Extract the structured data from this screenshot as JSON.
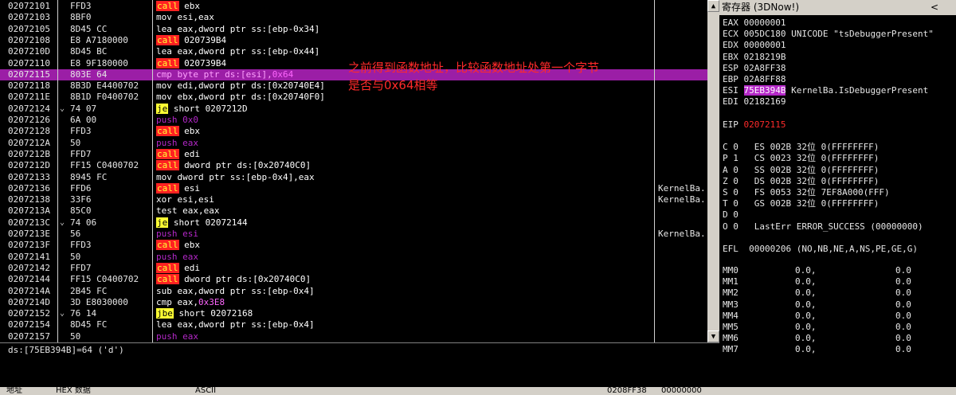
{
  "disasm": {
    "rows": [
      {
        "addr": "02072101",
        "jmp": "",
        "hex": "FFD3",
        "asm": [
          [
            "call",
            "call"
          ],
          [
            "ebx",
            "norm"
          ]
        ],
        "cmt": ""
      },
      {
        "addr": "02072103",
        "jmp": "",
        "hex": "8BF0",
        "asm": [
          [
            "mov esi,eax",
            "norm"
          ]
        ],
        "cmt": ""
      },
      {
        "addr": "02072105",
        "jmp": "",
        "hex": "8D45 CC",
        "asm": [
          [
            "lea eax,dword ptr ss:[ebp-0x34]",
            "norm"
          ]
        ],
        "cmt": ""
      },
      {
        "addr": "02072108",
        "jmp": "",
        "hex": "E8 A7180000",
        "asm": [
          [
            "call",
            "call"
          ],
          [
            "020739B4",
            "norm"
          ]
        ],
        "cmt": ""
      },
      {
        "addr": "0207210D",
        "jmp": "",
        "hex": "8D45 BC",
        "asm": [
          [
            "lea eax,dword ptr ss:[ebp-0x44]",
            "norm"
          ]
        ],
        "cmt": ""
      },
      {
        "addr": "02072110",
        "jmp": "",
        "hex": "E8 9F180000",
        "asm": [
          [
            "call",
            "call"
          ],
          [
            "020739B4",
            "norm"
          ]
        ],
        "cmt": ""
      },
      {
        "addr": "02072115",
        "jmp": "",
        "hex": "803E 64",
        "asm": [
          [
            "cmp byte ptr ds:[esi],",
            "cmp"
          ],
          [
            "0x64",
            "imm"
          ]
        ],
        "cmt": "",
        "sel": true
      },
      {
        "addr": "02072118",
        "jmp": "",
        "hex": "8B3D E4400702",
        "asm": [
          [
            "mov edi,dword ptr ds:[0x20740E4]",
            "norm"
          ]
        ],
        "cmt": ""
      },
      {
        "addr": "0207211E",
        "jmp": "",
        "hex": "8B1D F0400702",
        "asm": [
          [
            "mov ebx,dword ptr ds:[0x20740F0]",
            "norm"
          ]
        ],
        "cmt": ""
      },
      {
        "addr": "02072124",
        "jmp": "⌄",
        "hex": "74 07",
        "asm": [
          [
            "je",
            "jcc"
          ],
          [
            "short 0207212D",
            "norm"
          ]
        ],
        "cmt": ""
      },
      {
        "addr": "02072126",
        "jmp": "",
        "hex": "6A 00",
        "asm": [
          [
            "push 0x0",
            "push"
          ]
        ],
        "cmt": ""
      },
      {
        "addr": "02072128",
        "jmp": "",
        "hex": "FFD3",
        "asm": [
          [
            "call",
            "call"
          ],
          [
            "ebx",
            "norm"
          ]
        ],
        "cmt": ""
      },
      {
        "addr": "0207212A",
        "jmp": "",
        "hex": "50",
        "asm": [
          [
            "push eax",
            "push"
          ]
        ],
        "cmt": ""
      },
      {
        "addr": "0207212B",
        "jmp": "",
        "hex": "FFD7",
        "asm": [
          [
            "call",
            "call"
          ],
          [
            "edi",
            "norm"
          ]
        ],
        "cmt": ""
      },
      {
        "addr": "0207212D",
        "jmp": "",
        "hex": "FF15 C0400702",
        "asm": [
          [
            "call",
            "call"
          ],
          [
            "dword ptr ds:[0x20740C0]",
            "norm"
          ]
        ],
        "cmt": ""
      },
      {
        "addr": "02072133",
        "jmp": "",
        "hex": "8945 FC",
        "asm": [
          [
            "mov dword ptr ss:[ebp-0x4],eax",
            "norm"
          ]
        ],
        "cmt": ""
      },
      {
        "addr": "02072136",
        "jmp": "",
        "hex": "FFD6",
        "asm": [
          [
            "call",
            "call"
          ],
          [
            "esi",
            "norm"
          ]
        ],
        "cmt": "KernelBa."
      },
      {
        "addr": "02072138",
        "jmp": "",
        "hex": "33F6",
        "asm": [
          [
            "xor esi,esi",
            "norm"
          ]
        ],
        "cmt": "KernelBa."
      },
      {
        "addr": "0207213A",
        "jmp": "",
        "hex": "85C0",
        "asm": [
          [
            "test eax,eax",
            "norm"
          ]
        ],
        "cmt": ""
      },
      {
        "addr": "0207213C",
        "jmp": "⌄",
        "hex": "74 06",
        "asm": [
          [
            "je",
            "jcc"
          ],
          [
            "short 02072144",
            "norm"
          ]
        ],
        "cmt": ""
      },
      {
        "addr": "0207213E",
        "jmp": "",
        "hex": "56",
        "asm": [
          [
            "push esi",
            "push"
          ]
        ],
        "cmt": "KernelBa."
      },
      {
        "addr": "0207213F",
        "jmp": "",
        "hex": "FFD3",
        "asm": [
          [
            "call",
            "call"
          ],
          [
            "ebx",
            "norm"
          ]
        ],
        "cmt": ""
      },
      {
        "addr": "02072141",
        "jmp": "",
        "hex": "50",
        "asm": [
          [
            "push eax",
            "push"
          ]
        ],
        "cmt": ""
      },
      {
        "addr": "02072142",
        "jmp": "",
        "hex": "FFD7",
        "asm": [
          [
            "call",
            "call"
          ],
          [
            "edi",
            "norm"
          ]
        ],
        "cmt": ""
      },
      {
        "addr": "02072144",
        "jmp": "",
        "hex": "FF15 C0400702",
        "asm": [
          [
            "call",
            "call"
          ],
          [
            "dword ptr ds:[0x20740C0]",
            "norm"
          ]
        ],
        "cmt": ""
      },
      {
        "addr": "0207214A",
        "jmp": "",
        "hex": "2B45 FC",
        "asm": [
          [
            "sub eax,dword ptr ss:[ebp-0x4]",
            "norm"
          ]
        ],
        "cmt": ""
      },
      {
        "addr": "0207214D",
        "jmp": "",
        "hex": "3D E8030000",
        "asm": [
          [
            "cmp eax,",
            "norm"
          ],
          [
            "0x3E8",
            "imm"
          ]
        ],
        "cmt": ""
      },
      {
        "addr": "02072152",
        "jmp": "⌄",
        "hex": "76 14",
        "asm": [
          [
            "jbe",
            "jcc"
          ],
          [
            "short 02072168",
            "norm"
          ]
        ],
        "cmt": ""
      },
      {
        "addr": "02072154",
        "jmp": "",
        "hex": "8D45 FC",
        "asm": [
          [
            "lea eax,dword ptr ss:[ebp-0x4]",
            "norm"
          ]
        ],
        "cmt": ""
      },
      {
        "addr": "02072157",
        "jmp": "",
        "hex": "50",
        "asm": [
          [
            "push eax",
            "push"
          ]
        ],
        "cmt": ""
      }
    ],
    "annotation_line1": "之前得到函数地址，比较函数地址处第一个字节",
    "annotation_line2": "是否与0x64相等"
  },
  "info": {
    "text": "ds:[75EB394B]=64 ('d')"
  },
  "registers": {
    "title": "寄存器 (3DNow!)",
    "chevron": "<",
    "gpr": [
      {
        "name": "EAX",
        "value": "00000001",
        "note": ""
      },
      {
        "name": "ECX",
        "value": "005DC180",
        "note": "UNICODE \"tsDebuggerPresent\""
      },
      {
        "name": "EDX",
        "value": "00000001",
        "note": ""
      },
      {
        "name": "EBX",
        "value": "0218219B",
        "note": ""
      },
      {
        "name": "ESP",
        "value": "02A8FF38",
        "note": ""
      },
      {
        "name": "EBP",
        "value": "02A8FF88",
        "note": ""
      },
      {
        "name": "ESI",
        "value": "75EB394B",
        "note": "KernelBa.IsDebuggerPresent",
        "highlight": true
      },
      {
        "name": "EDI",
        "value": "02182169",
        "note": ""
      }
    ],
    "eip": {
      "name": "EIP",
      "value": "02072115"
    },
    "flags": [
      "C 0   ES 002B 32位 0(FFFFFFFF)",
      "P 1   CS 0023 32位 0(FFFFFFFF)",
      "A 0   SS 002B 32位 0(FFFFFFFF)",
      "Z 0   DS 002B 32位 0(FFFFFFFF)",
      "S 0   FS 0053 32位 7EF8A000(FFF)",
      "T 0   GS 002B 32位 0(FFFFFFFF)",
      "D 0",
      "O 0   LastErr ERROR_SUCCESS (00000000)"
    ],
    "efl": "EFL  00000206 (NO,NB,NE,A,NS,PE,GE,G)",
    "mm": [
      {
        "name": "MM0",
        "a": "0.0,",
        "b": "0.0"
      },
      {
        "name": "MM1",
        "a": "0.0,",
        "b": "0.0"
      },
      {
        "name": "MM2",
        "a": "0.0,",
        "b": "0.0"
      },
      {
        "name": "MM3",
        "a": "0.0,",
        "b": "0.0"
      },
      {
        "name": "MM4",
        "a": "0.0,",
        "b": "0.0"
      },
      {
        "name": "MM5",
        "a": "0.0,",
        "b": "0.0"
      },
      {
        "name": "MM6",
        "a": "0.0,",
        "b": "0.0"
      },
      {
        "name": "MM7",
        "a": "0.0,",
        "b": "0.0"
      }
    ]
  },
  "bottombar": {
    "col1": "地址",
    "col2": "HEX 数据",
    "col3": "ASCII",
    "col4": "0208FF38",
    "col5": "00000000"
  },
  "colors": {
    "selection": "#9b1ea6",
    "call_bg": "#ff2222",
    "call_fg": "#ffff33",
    "jcc_bg": "#ffff33",
    "annotation": "#ff2a2a"
  }
}
